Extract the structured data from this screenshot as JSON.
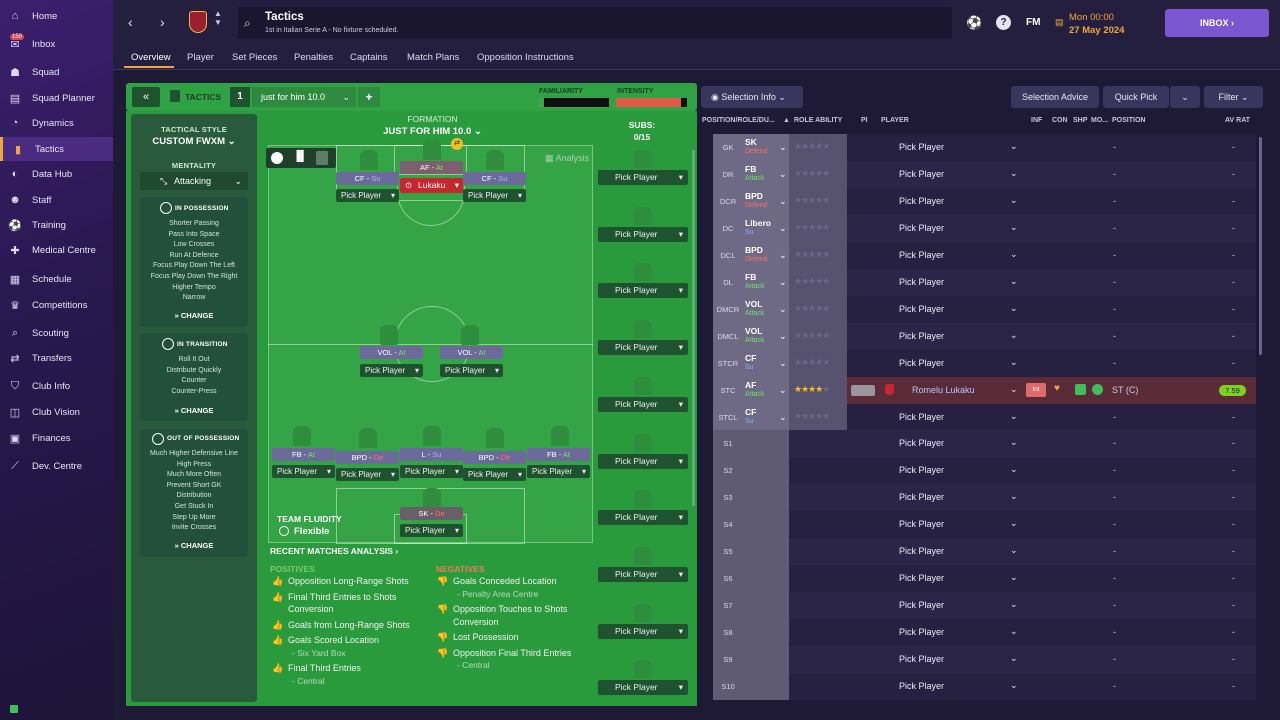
{
  "sidebar": {
    "items": [
      {
        "icon": "home-icon",
        "label": "Home"
      },
      {
        "icon": "inbox-icon",
        "label": "Inbox",
        "badge": "150"
      },
      {
        "icon": "squad-icon",
        "label": "Squad"
      },
      {
        "icon": "squad-planner-icon",
        "label": "Squad Planner"
      },
      {
        "icon": "dynamics-icon",
        "label": "Dynamics"
      },
      {
        "icon": "tactics-icon",
        "label": "Tactics"
      },
      {
        "icon": "data-hub-icon",
        "label": "Data Hub"
      },
      {
        "icon": "staff-icon",
        "label": "Staff"
      },
      {
        "icon": "training-icon",
        "label": "Training"
      },
      {
        "icon": "medical-icon",
        "label": "Medical Centre"
      },
      {
        "icon": "schedule-icon",
        "label": "Schedule"
      },
      {
        "icon": "trophy-icon",
        "label": "Competitions"
      },
      {
        "icon": "scouting-icon",
        "label": "Scouting"
      },
      {
        "icon": "transfers-icon",
        "label": "Transfers"
      },
      {
        "icon": "club-info-icon",
        "label": "Club Info"
      },
      {
        "icon": "club-vision-icon",
        "label": "Club Vision"
      },
      {
        "icon": "finances-icon",
        "label": "Finances"
      },
      {
        "icon": "dev-centre-icon",
        "label": "Dev. Centre"
      }
    ]
  },
  "topbar": {
    "title": "Tactics",
    "subtitle": "1st in Italian Serie A - No fixture scheduled.",
    "fm_label": "FM",
    "day_time": "Mon 00:00",
    "date": "27 May 2024",
    "inbox_label": "INBOX"
  },
  "subnav": [
    "Overview",
    "Player",
    "Set Pieces",
    "Penalties",
    "Captains",
    "Match Plans",
    "Opposition Instructions"
  ],
  "tacbar": {
    "tactics_label": "TACTICS",
    "slot": "1",
    "tactic_name": "just for him 10.0",
    "familiarity_label": "FAMILIARITY",
    "intensity_label": "INTENSITY",
    "familiarity_level": 0.08,
    "intensity_level": 0.92
  },
  "style": {
    "tactical_style_label": "TACTICAL STYLE",
    "tactical_style": "CUSTOM FWXM",
    "mentality_label": "MENTALITY",
    "mentality": "Attacking",
    "in_possession_label": "IN POSSESSION",
    "in_possession": [
      "Shorter Passing",
      "Pass Into Space",
      "Low Crosses",
      "Run At Defence",
      "Focus Play Down The Left",
      "Focus Play Down The Right",
      "Higher Tempo",
      "Narrow"
    ],
    "in_transition_label": "IN TRANSITION",
    "in_transition": [
      "Roll It Out",
      "Distribute Quickly",
      "Counter",
      "Counter-Press"
    ],
    "out_of_possession_label": "OUT OF POSSESSION",
    "out_of_possession": [
      "Much Higher Defensive Line",
      "High Press",
      "Much More Often",
      "Prevent Short GK",
      "Distribution",
      "Get Stuck In",
      "Step Up More",
      "Invite Crosses"
    ],
    "change_label": "CHANGE"
  },
  "formation": {
    "label": "FORMATION",
    "name": "JUST FOR HIM 10.0",
    "subs_label": "SUBS:",
    "subs_count": "0/15",
    "analysis_label": "Analysis",
    "team_fluidity_label": "TEAM FLUIDITY",
    "team_fluidity": "Flexible",
    "pick_label": "Pick Player",
    "lukaku": "Lukaku"
  },
  "analysis": {
    "title": "RECENT MATCHES ANALYSIS",
    "positives_label": "POSITIVES",
    "negatives_label": "NEGATIVES",
    "positives": [
      {
        "text": "Opposition Long-Range Shots",
        "sub": ""
      },
      {
        "text": "Final Third Entries to Shots Conversion",
        "sub": ""
      },
      {
        "text": "Goals from Long-Range Shots",
        "sub": ""
      },
      {
        "text": "Goals Scored Location",
        "sub": "- Six Yard Box"
      },
      {
        "text": "Final Third Entries",
        "sub": "- Central"
      }
    ],
    "negatives": [
      {
        "text": "Goals Conceded Location",
        "sub": "- Penalty Area Centre"
      },
      {
        "text": "Opposition Touches to Shots Conversion",
        "sub": ""
      },
      {
        "text": "Lost Possession",
        "sub": ""
      },
      {
        "text": "Opposition Final Third Entries",
        "sub": "- Central"
      }
    ]
  },
  "table": {
    "selection_info": "Selection Info",
    "selection_advice": "Selection Advice",
    "quick_pick": "Quick Pick",
    "filter": "Filter",
    "headers": [
      "POSITION/ROLE/DU...",
      "ROLE ABILITY",
      "PI",
      "PLAYER",
      "INF",
      "CON",
      "SHP",
      "MO...",
      "POSITION",
      "AV RAT"
    ],
    "rows": [
      {
        "pos": "GK",
        "role": "SK",
        "duty": "Defend",
        "player": "Pick Player",
        "position": "-",
        "rating": "-"
      },
      {
        "pos": "DR",
        "role": "FB",
        "duty": "Attack",
        "player": "Pick Player",
        "position": "-",
        "rating": "-"
      },
      {
        "pos": "DCR",
        "role": "BPD",
        "duty": "Defend",
        "player": "Pick Player",
        "position": "-",
        "rating": "-"
      },
      {
        "pos": "DC",
        "role": "Libero",
        "duty": "Su",
        "player": "Pick Player",
        "position": "-",
        "rating": "-"
      },
      {
        "pos": "DCL",
        "role": "BPD",
        "duty": "Defend",
        "player": "Pick Player",
        "position": "-",
        "rating": "-"
      },
      {
        "pos": "DL",
        "role": "FB",
        "duty": "Attack",
        "player": "Pick Player",
        "position": "-",
        "rating": "-"
      },
      {
        "pos": "DMCR",
        "role": "VOL",
        "duty": "Attack",
        "player": "Pick Player",
        "position": "-",
        "rating": "-"
      },
      {
        "pos": "DMCL",
        "role": "VOL",
        "duty": "Attack",
        "player": "Pick Player",
        "position": "-",
        "rating": "-"
      },
      {
        "pos": "STCR",
        "role": "CF",
        "duty": "Su",
        "player": "Pick Player",
        "position": "-",
        "rating": "-"
      },
      {
        "pos": "STC",
        "role": "AF",
        "duty": "Attack",
        "player": "Romelu Lukaku",
        "position": "ST (C)",
        "rating": "7.59",
        "inf": "Int"
      },
      {
        "pos": "STCL",
        "role": "CF",
        "duty": "Su",
        "player": "Pick Player",
        "position": "-",
        "rating": "-"
      },
      {
        "pos": "S1",
        "role": "",
        "duty": "",
        "player": "Pick Player",
        "position": "-",
        "rating": "-"
      },
      {
        "pos": "S2",
        "role": "",
        "duty": "",
        "player": "Pick Player",
        "position": "-",
        "rating": "-"
      },
      {
        "pos": "S3",
        "role": "",
        "duty": "",
        "player": "Pick Player",
        "position": "-",
        "rating": "-"
      },
      {
        "pos": "S4",
        "role": "",
        "duty": "",
        "player": "Pick Player",
        "position": "-",
        "rating": "-"
      },
      {
        "pos": "S5",
        "role": "",
        "duty": "",
        "player": "Pick Player",
        "position": "-",
        "rating": "-"
      },
      {
        "pos": "S6",
        "role": "",
        "duty": "",
        "player": "Pick Player",
        "position": "-",
        "rating": "-"
      },
      {
        "pos": "S7",
        "role": "",
        "duty": "",
        "player": "Pick Player",
        "position": "-",
        "rating": "-"
      },
      {
        "pos": "S8",
        "role": "",
        "duty": "",
        "player": "Pick Player",
        "position": "-",
        "rating": "-"
      },
      {
        "pos": "S9",
        "role": "",
        "duty": "",
        "player": "Pick Player",
        "position": "-",
        "rating": "-"
      },
      {
        "pos": "S10",
        "role": "",
        "duty": "",
        "player": "Pick Player",
        "position": "-",
        "rating": "-"
      }
    ]
  },
  "pitch_roles": {
    "cf_left": "CF - ",
    "cf_left_duty": "Su",
    "af": "AF - ",
    "af_duty": "At",
    "cf_right": "CF - ",
    "cf_right_duty": "Su",
    "vol_left": "VOL - ",
    "vol_left_duty": "At",
    "vol_right": "VOL - ",
    "vol_right_duty": "At",
    "fb_left": "FB - ",
    "fb_left_duty": "At",
    "bpd_left": "BPD - ",
    "bpd_left_duty": "De",
    "libero": "L - ",
    "libero_duty": "Su",
    "bpd_right": "BPD - ",
    "bpd_right_duty": "De",
    "fb_right": "FB - ",
    "fb_right_duty": "At",
    "sk": "SK - ",
    "sk_duty": "De"
  },
  "colors": {
    "accent": "#f0a63a",
    "pitch": "#2a9b3c",
    "inbox": "#7a57d1",
    "attack": "#5fd66a",
    "defend": "#f05a5a",
    "support": "#6a8cf0"
  }
}
